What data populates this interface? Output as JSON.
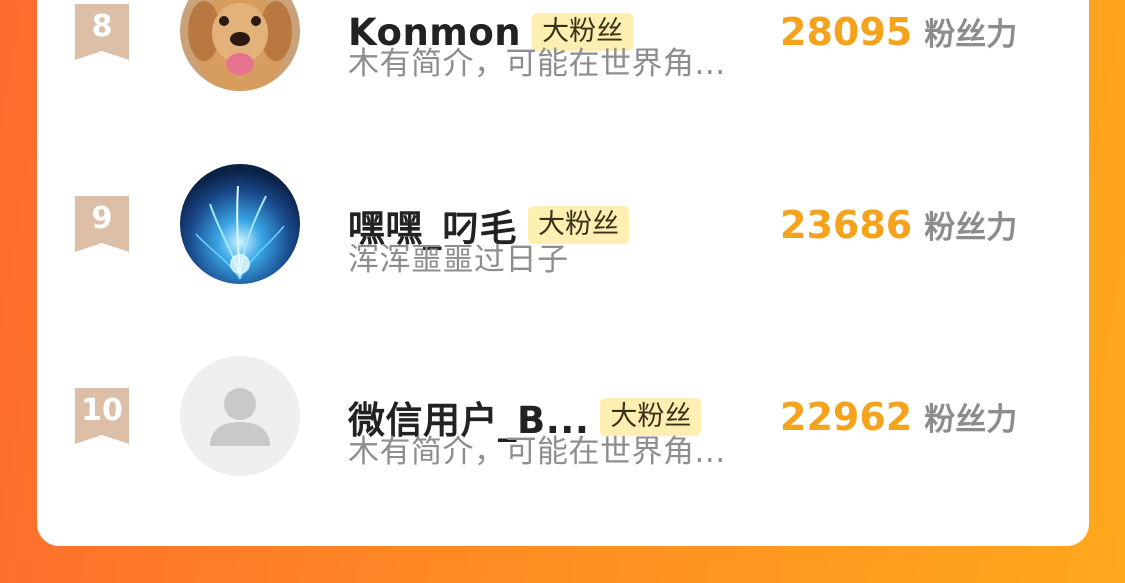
{
  "ranking": {
    "entries": [
      {
        "rank": "8",
        "name": "Konmon",
        "badge": "大粉丝",
        "bio": "木有简介，可能在世界角...",
        "score": "28095",
        "score_unit": "粉丝力",
        "avatar": "golden-retriever-dog"
      },
      {
        "rank": "9",
        "name": "嘿嘿_叼毛",
        "badge": "大粉丝",
        "bio": "浑浑噩噩过日子",
        "score": "23686",
        "score_unit": "粉丝力",
        "avatar": "blue-sparkle-abstract"
      },
      {
        "rank": "10",
        "name": "微信用户_B...",
        "badge": "大粉丝",
        "bio": "木有简介，可能在世界角...",
        "score": "22962",
        "score_unit": "粉丝力",
        "avatar": "default-person-icon"
      }
    ]
  },
  "colors": {
    "background_gradient_start": "#ff6a2e",
    "background_gradient_end": "#ffa81c",
    "score": "#f5a21c",
    "badge_background": "#fdeeb2",
    "rank_ribbon": "#d9bba2"
  }
}
